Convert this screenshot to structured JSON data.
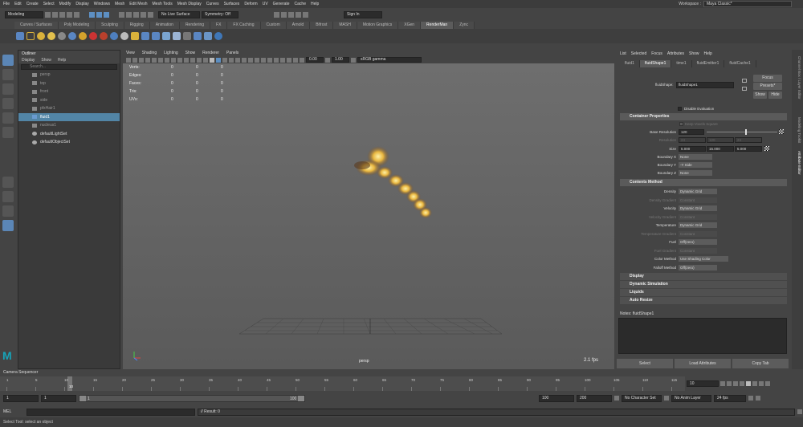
{
  "menubar": {
    "items": [
      "File",
      "Edit",
      "Create",
      "Select",
      "Modify",
      "Display",
      "Windows",
      "Mesh",
      "Edit Mesh",
      "Mesh Tools",
      "Mesh Display",
      "Curves",
      "Surfaces",
      "Deform",
      "UV",
      "Generate",
      "Cache",
      "Help"
    ],
    "workspace_label": "Workspace :",
    "workspace_value": "Maya Classic*"
  },
  "statusline": {
    "mode": "Modeling",
    "live_surface": "No Live Surface",
    "symmetry": "Symmetry: Off",
    "signin": "Sign In"
  },
  "shelf": {
    "tabs": [
      "Curves / Surfaces",
      "Poly Modeling",
      "Sculpting",
      "Rigging",
      "Animation",
      "Rendering",
      "FX",
      "FX Caching",
      "Custom",
      "Arnold",
      "Bifrost",
      "MASH",
      "Motion Graphics",
      "XGen",
      "RenderMan",
      "Zync"
    ],
    "active_tab": "RenderMan"
  },
  "outliner": {
    "title": "Outliner",
    "menu": [
      "Display",
      "Show",
      "Help"
    ],
    "search_placeholder": "Search...",
    "items": [
      {
        "label": "persp",
        "type": "camera",
        "state": "dim"
      },
      {
        "label": "top",
        "type": "camera",
        "state": "dim"
      },
      {
        "label": "front",
        "type": "camera",
        "state": "dim"
      },
      {
        "label": "side",
        "type": "camera",
        "state": "dim"
      },
      {
        "label": "pfxHair1",
        "type": "group",
        "state": "dim"
      },
      {
        "label": "fluid1",
        "type": "fluid",
        "state": "selected"
      },
      {
        "label": "nucleus1",
        "type": "node",
        "state": "dim"
      },
      {
        "label": "defaultLightSet",
        "type": "set",
        "state": "normal"
      },
      {
        "label": "defaultObjectSet",
        "type": "set",
        "state": "normal"
      }
    ]
  },
  "viewport": {
    "menu": [
      "View",
      "Shading",
      "Lighting",
      "Show",
      "Renderer",
      "Panels"
    ],
    "exposure": "0.00",
    "gamma": "1.00",
    "color_space": "sRGB gamma",
    "hud": {
      "rows": [
        "Verts:",
        "Edges:",
        "Faces:",
        "Tris:",
        "UVs:"
      ],
      "col1": [
        "0",
        "0",
        "0",
        "0",
        "0"
      ],
      "col2": [
        "0",
        "0",
        "0",
        "0",
        "0"
      ],
      "col3": [
        "0",
        "0",
        "0",
        "0",
        "0"
      ]
    },
    "camera_label": "persp",
    "fps": "2.1 fps"
  },
  "attribute_editor": {
    "menu": [
      "List",
      "Selected",
      "Focus",
      "Attributes",
      "Show",
      "Help"
    ],
    "tabs": [
      "fluid1",
      "fluidShape1",
      "time1",
      "fluidEmitter1",
      "fluidCache1"
    ],
    "active_tab": "fluidShape1",
    "node_label": "fluidShape:",
    "node_value": "fluidShape1",
    "focus_btn": "Focus",
    "presets_btn": "Presets*",
    "show_btn": "Show",
    "hide_btn": "Hide",
    "disable_eval": "Disable Evaluation",
    "sections": {
      "container": "Container Properties",
      "contents": "Contents Method",
      "display": "Display",
      "dynamic": "Dynamic Simulation",
      "liquids": "Liquids",
      "auto_resize": "Auto Resize"
    },
    "container": {
      "keep_square": "Keep Voxels Square",
      "base_res_label": "Base Resolution",
      "base_res_value": "120",
      "resolution_label": "Resolution",
      "resolution_values": [
        "24",
        "120",
        "24"
      ],
      "size_label": "Size",
      "size_values": [
        "5.000",
        "15.000",
        "5.000"
      ],
      "bx_label": "Boundary X",
      "bx_value": "None",
      "by_label": "Boundary Y",
      "by_value": "-Y Side",
      "bz_label": "Boundary Z",
      "bz_value": "None"
    },
    "contents": [
      {
        "label": "Density",
        "value": "Dynamic Grid",
        "dim": false
      },
      {
        "label": "Density Gradient",
        "value": "Constant",
        "dim": true
      },
      {
        "label": "Velocity",
        "value": "Dynamic Grid",
        "dim": false
      },
      {
        "label": "Velocity Gradient",
        "value": "Constant",
        "dim": true
      },
      {
        "label": "Temperature",
        "value": "Dynamic Grid",
        "dim": false
      },
      {
        "label": "Temperature Gradient",
        "value": "Constant",
        "dim": true
      },
      {
        "label": "Fuel",
        "value": "Off(zero)",
        "dim": false
      },
      {
        "label": "Fuel Gradient",
        "value": "Constant",
        "dim": true
      },
      {
        "label": "Color Method",
        "value": "Use Shading Color",
        "dim": false
      },
      {
        "label": "Falloff Method",
        "value": "Off(zero)",
        "dim": false
      }
    ],
    "notes_label": "Notes:  fluidShape1",
    "bottom_buttons": [
      "Select",
      "Load Attributes",
      "Copy Tab"
    ]
  },
  "right_tabs": [
    "Channel Box / Layer Editor",
    "Modeling Toolkit",
    "Attribute Editor"
  ],
  "timeline": {
    "label": "Camera Sequencer",
    "ticks": [
      "1",
      "5",
      "10",
      "15",
      "20",
      "25",
      "30",
      "35",
      "40",
      "45",
      "50",
      "55",
      "60",
      "65",
      "70",
      "75",
      "80",
      "85",
      "90",
      "95",
      "100",
      "105",
      "110",
      "115"
    ],
    "current_frame": "10",
    "current_field": "10"
  },
  "range": {
    "start": "1",
    "start2": "1",
    "slider_start": "1",
    "slider_end": "100",
    "end": "100",
    "end2": "200",
    "character_set": "No Character Set",
    "anim_layer": "No Anim Layer",
    "fps": "24 fps"
  },
  "cmdline": {
    "lang": "MEL",
    "result": "// Result: 0"
  },
  "helpline": "Select Tool: select an object"
}
